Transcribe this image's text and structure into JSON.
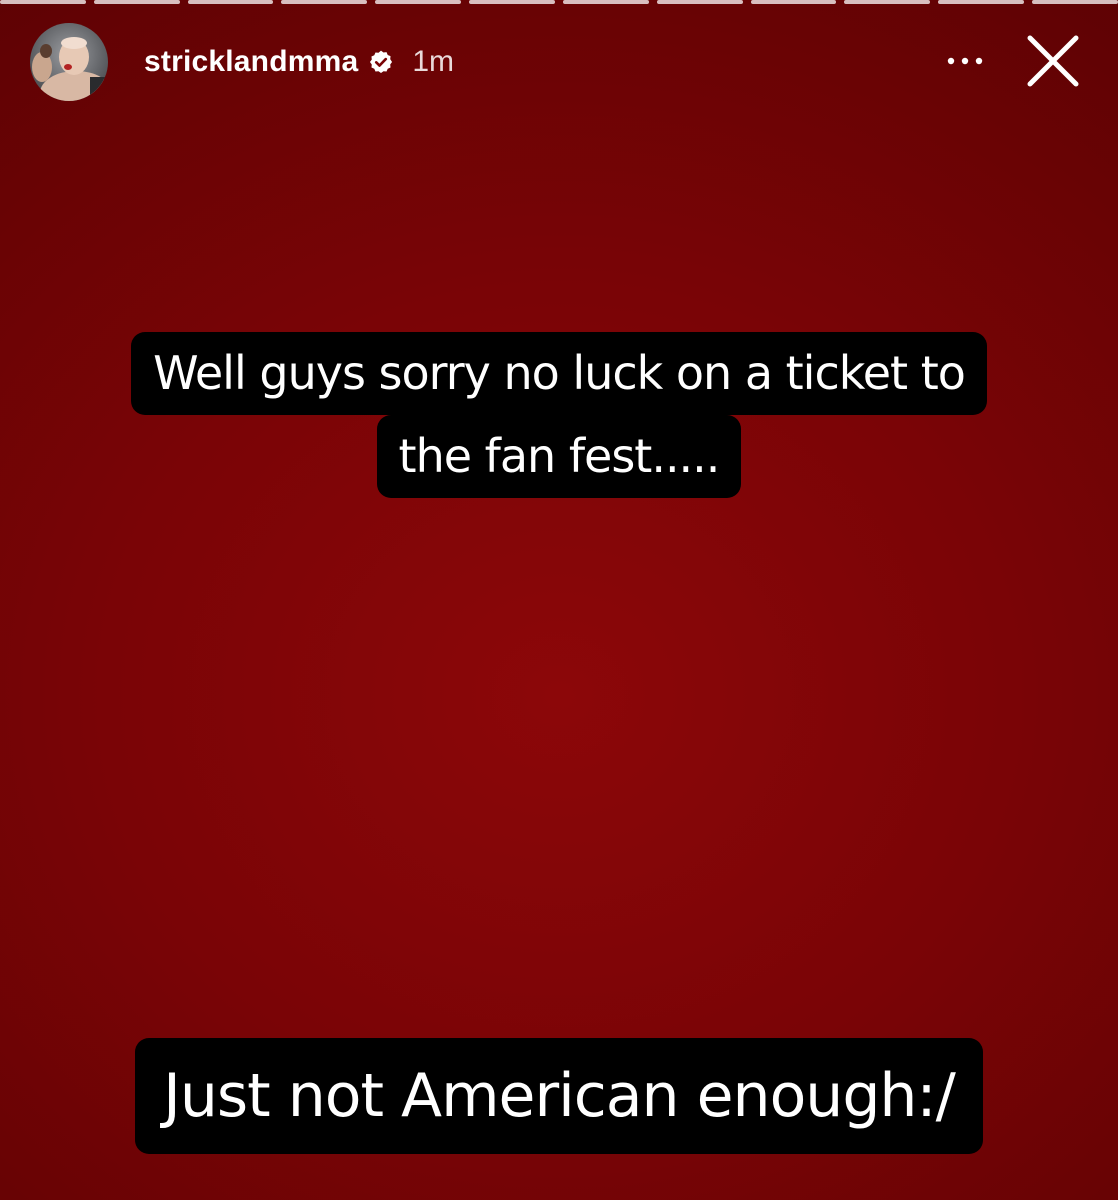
{
  "story": {
    "progress_segments": 12,
    "background_color": "#7a0406",
    "author": {
      "username": "stricklandmma",
      "verified": true,
      "time": "1m"
    },
    "controls": {
      "more_icon": "more-horizontal-icon",
      "close_icon": "close-icon"
    },
    "captions": [
      {
        "lines": [
          "Well guys sorry no luck on a ticket to",
          "the fan fest....."
        ]
      },
      {
        "lines": [
          "Just not American enough:/"
        ]
      }
    ]
  }
}
